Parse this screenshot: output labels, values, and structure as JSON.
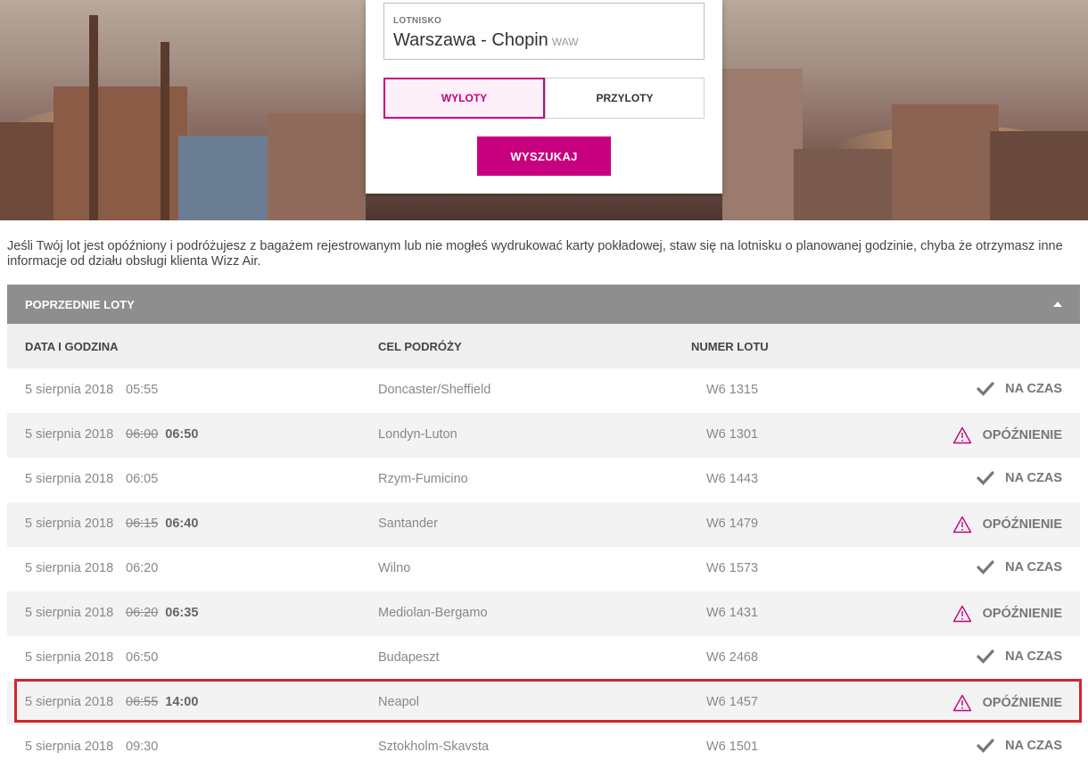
{
  "search": {
    "airport_label": "LOTNISKO",
    "airport_value": "Warszawa - Chopin",
    "airport_code": "WAW",
    "departures_label": "WYLOTY",
    "arrivals_label": "PRZYLOTY",
    "search_button": "WYSZUKAJ"
  },
  "notice": "Jeśli Twój lot jest opóźniony i podróżujesz z bagażem rejestrowanym lub nie mogłeś wydrukować karty pokładowej, staw się na lotnisku o planowanej godzinie, chyba że otrzymasz inne informacje od działu obsługi klienta Wizz Air.",
  "panel": {
    "title": "POPRZEDNIE LOTY",
    "columns": {
      "date": "DATA I GODZINA",
      "destination": "CEL PODRÓŻY",
      "flight": "NUMER LOTU"
    }
  },
  "flights": [
    {
      "date": "5 sierpnia 2018",
      "time": "05:55",
      "new_time": "",
      "destination": "Doncaster/Sheffield",
      "flight": "W6 1315",
      "status": "NA CZAS",
      "status_icon": "check-icon"
    },
    {
      "date": "5 sierpnia 2018",
      "time": "06:00",
      "new_time": "06:50",
      "destination": "Londyn-Luton",
      "flight": "W6 1301",
      "status": "OPÓŹNIENIE",
      "status_icon": "warning-icon"
    },
    {
      "date": "5 sierpnia 2018",
      "time": "06:05",
      "new_time": "",
      "destination": "Rzym-Fumicino",
      "flight": "W6 1443",
      "status": "NA CZAS",
      "status_icon": "check-icon"
    },
    {
      "date": "5 sierpnia 2018",
      "time": "06:15",
      "new_time": "06:40",
      "destination": "Santander",
      "flight": "W6 1479",
      "status": "OPÓŹNIENIE",
      "status_icon": "warning-icon"
    },
    {
      "date": "5 sierpnia 2018",
      "time": "06:20",
      "new_time": "",
      "destination": "Wilno",
      "flight": "W6 1573",
      "status": "NA CZAS",
      "status_icon": "check-icon"
    },
    {
      "date": "5 sierpnia 2018",
      "time": "06:20",
      "new_time": "06:35",
      "destination": "Mediolan-Bergamo",
      "flight": "W6 1431",
      "status": "OPÓŹNIENIE",
      "status_icon": "warning-icon"
    },
    {
      "date": "5 sierpnia 2018",
      "time": "06:50",
      "new_time": "",
      "destination": "Budapeszt",
      "flight": "W6 2468",
      "status": "NA CZAS",
      "status_icon": "check-icon"
    },
    {
      "date": "5 sierpnia 2018",
      "time": "06:55",
      "new_time": "14:00",
      "destination": "Neapol",
      "flight": "W6 1457",
      "status": "OPÓŹNIENIE",
      "status_icon": "warning-icon"
    },
    {
      "date": "5 sierpnia 2018",
      "time": "09:30",
      "new_time": "",
      "destination": "Sztokholm-Skavsta",
      "flight": "W6 1501",
      "status": "NA CZAS",
      "status_icon": "check-icon"
    }
  ],
  "colors": {
    "brand": "#c6007e",
    "panel_header": "#8e8e8e",
    "highlight": "#d6232f",
    "warning": "#c6007e",
    "check": "#777777"
  }
}
